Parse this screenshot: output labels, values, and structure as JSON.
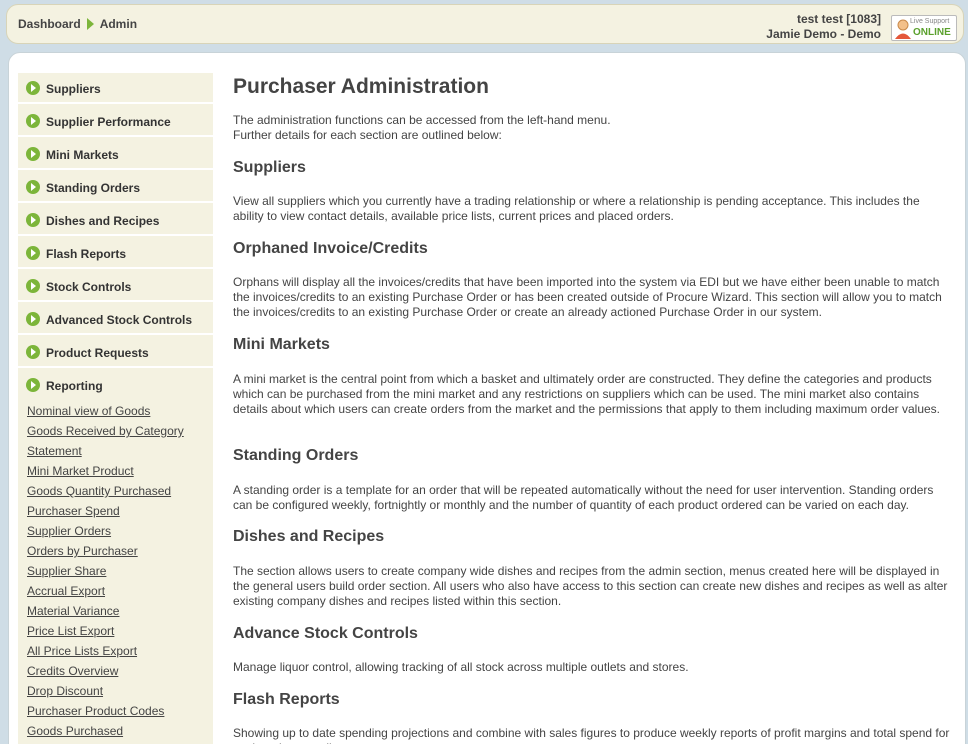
{
  "breadcrumb": {
    "home": "Dashboard",
    "current": "Admin"
  },
  "user": {
    "line1": "test test [1083]",
    "line2": "Jamie Demo - Demo"
  },
  "live_support": {
    "top": "Live Support",
    "status": "ONLINE"
  },
  "menu": [
    {
      "label": "Suppliers"
    },
    {
      "label": "Supplier Performance"
    },
    {
      "label": "Mini Markets"
    },
    {
      "label": "Standing Orders"
    },
    {
      "label": "Dishes and Recipes"
    },
    {
      "label": "Flash Reports"
    },
    {
      "label": "Stock Controls"
    },
    {
      "label": "Advanced Stock Controls"
    },
    {
      "label": "Product Requests"
    },
    {
      "label": "Reporting"
    }
  ],
  "reporting_links": [
    "Nominal view of Goods",
    "Goods Received by Category",
    "Statement",
    "Mini Market Product",
    "Goods Quantity Purchased",
    "Purchaser Spend",
    "Supplier Orders",
    "Orders by Purchaser",
    "Supplier Share",
    "Accrual Export",
    "Material Variance",
    "Price List Export",
    "All Price Lists Export",
    "Credits Overview",
    "Drop Discount",
    "Purchaser Product Codes",
    "Goods Purchased"
  ],
  "page": {
    "title": "Purchaser Administration",
    "intro_1": "The administration functions can be accessed from the left-hand menu.",
    "intro_2": "Further details for each section are outlined below:"
  },
  "sections": [
    {
      "heading": "Suppliers",
      "body": "View all suppliers which you currently have a trading relationship or where a relationship is pending acceptance. This includes the ability to view contact details, available price lists, current prices and placed orders."
    },
    {
      "heading": "Orphaned Invoice/Credits",
      "body": "Orphans will display all the invoices/credits that have been imported into the system via EDI but we have either been unable to match the invoices/credits to an existing Purchase Order or has been created outside of Procure Wizard. This section will allow you to match the invoices/credits to an existing Purchase Order or create an already actioned Purchase Order in our system."
    },
    {
      "heading": "Mini Markets",
      "body": "A mini market is the central point from which a basket and ultimately order are constructed. They define the categories and products which can be purchased from the mini market and any restrictions on suppliers which can be used. The mini market also contains details about which users can create orders from the market and the permissions that apply to them including maximum order values."
    },
    {
      "heading": "Standing Orders",
      "body": "A standing order is a template for an order that will be repeated automatically without the need for user intervention. Standing orders can be configured weekly, fortnightly or monthly and the number of quantity of each product ordered can be varied on each day."
    },
    {
      "heading": "Dishes and Recipes",
      "body": "The section allows users to create company wide dishes and recipes from the admin section, menus created here will be displayed in the general users build order section. All users who also have access to this section can create new dishes and recipes as well as alter existing company dishes and recipes listed within this section."
    },
    {
      "heading": "Advance Stock Controls",
      "body": "Manage liquor control, allowing tracking of all stock across multiple outlets and stores."
    },
    {
      "heading": "Flash Reports",
      "body": "Showing up to date spending projections and combine with sales figures to produce weekly reports of profit margins and total spend for each outlet as well"
    }
  ],
  "colors": {
    "accent": "#7cb53a",
    "sidebar_bg": "#f4f2e1",
    "topbar_bg": "#f4f2e1",
    "page_bg": "#cfdde6"
  }
}
